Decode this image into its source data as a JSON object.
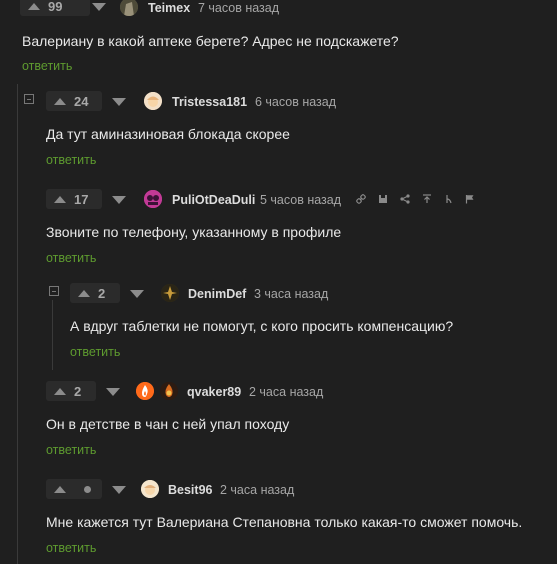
{
  "comments": [
    {
      "votes": "99",
      "username": "Teimex",
      "time": "7 часов назад",
      "text": "Валериану в какой аптеке берете? Адрес не подскажете?",
      "reply": "ответить"
    },
    {
      "votes": "24",
      "username": "Tristessa181",
      "time": "6 часов назад",
      "text": "Да тут аминазиновая блокада скорее",
      "reply": "ответить"
    },
    {
      "votes": "17",
      "username": "PuliOtDeaDuli",
      "time": "5 часов назад",
      "text": "Звоните по телефону, указанному в профиле",
      "reply": "ответить"
    },
    {
      "votes": "2",
      "username": "DenimDef",
      "time": "3 часа назад",
      "text": "А вдруг таблетки не помогут, с кого просить компенсацию?",
      "reply": "ответить"
    },
    {
      "votes": "2",
      "username": "qvaker89",
      "time": "2 часа назад",
      "text": "Он в детстве в чан с ней упал походу",
      "reply": "ответить"
    },
    {
      "username": "Besit96",
      "time": "2 часа назад",
      "text": "Мне кажется тут Валериана Степановна только какая-то сможет помочь.",
      "reply": "ответить"
    }
  ],
  "toolbar_icons": [
    "link-icon",
    "save-icon",
    "share-icon",
    "up-arrow-icon",
    "branch-icon",
    "flag-icon"
  ],
  "colors": {
    "background": "#1f1f1f",
    "reply": "#5e9b2f",
    "accent_avatar": "#ff6a1a"
  }
}
